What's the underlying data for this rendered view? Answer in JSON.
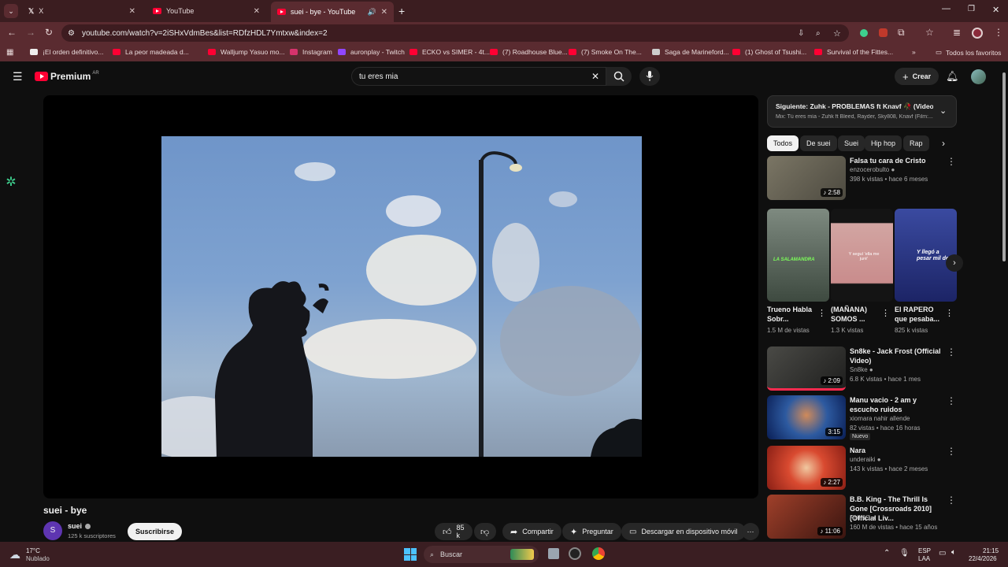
{
  "tabs": [
    {
      "label": "X"
    },
    {
      "label": "YouTube"
    },
    {
      "label": "suei - bye - YouTube"
    }
  ],
  "url": "youtube.com/watch?v=2iSHxVdmBes&list=RDfzHDL7Ymtxw&index=2",
  "bookmarks": [
    {
      "label": "¡El orden definitivo..."
    },
    {
      "label": "La peor madeada d..."
    },
    {
      "label": "Walljump Yasuo mo..."
    },
    {
      "label": "Instagram"
    },
    {
      "label": "auronplay - Twitch"
    },
    {
      "label": "ECKO vs SIMER - 4t..."
    },
    {
      "label": "(7) Roadhouse Blue..."
    },
    {
      "label": "(7) Smoke On The..."
    },
    {
      "label": "Saga de Marineford..."
    },
    {
      "label": "(1) Ghost of Tsushi..."
    },
    {
      "label": "Survival of the Fittes..."
    },
    {
      "label": "Todos los favoritos"
    }
  ],
  "yt": {
    "logo": "Premium",
    "region": "AR",
    "search_value": "tu eres mia",
    "create_label": "Crear"
  },
  "video": {
    "title": "suei - bye",
    "channel": "suei",
    "channel_initial": "S",
    "subscribers": "125 k suscriptores",
    "subscribe_label": "Suscribirse",
    "likes": "85 k",
    "share_label": "Compartir",
    "ask_label": "Preguntar",
    "download_label": "Descargar en dispositivo móvil"
  },
  "up_next": {
    "title": "Siguiente: Zuhk - PROBLEMAS ft Knavf 🥀 (Video ...",
    "subtitle": "Mix: Tú eres mía - Zuhk ft Bleed, Rayder, Sky808, Knavf (Film:..."
  },
  "chips": [
    "Todos",
    "De suei",
    "Suei",
    "Hip hop",
    "Rap"
  ],
  "recommendations": [
    {
      "title": "Falsa tu cara de Cristo",
      "channel": "enzocerobulto",
      "meta": "398 k vistas • hace 6 meses",
      "duration": "2:58",
      "color": "#6b6b5a"
    },
    {
      "title": "Sn8ke - Jack Frost (Official Video)",
      "channel": "Sn8ke",
      "meta": "6.8 K vistas • hace 1 mes",
      "duration": "2:09",
      "color": "#3a3a38"
    },
    {
      "title": "Manu vacio - 2 am y escucho ruidos",
      "channel": "xiomara nahir allende",
      "meta": "82 vistas • hace 16 horas",
      "duration": "3:15",
      "badge": "Nuevo",
      "color": "#2d5aa0"
    },
    {
      "title": "Nara",
      "channel": "underaiki",
      "meta": "143 k vistas • hace 2 meses",
      "duration": "2:27",
      "color": "#c4402a"
    },
    {
      "title": "B.B. King - The Thrill Is Gone [Crossroads 2010] (Official Liv...",
      "channel": "RHINO",
      "meta": "160 M de vistas • hace 15 años",
      "duration": "11:06",
      "color": "#7a2a20"
    }
  ],
  "shorts": [
    {
      "title": "Trueno Habla Sobr...",
      "views": "1.5 M de vistas",
      "overlay": "LA SALAMANDRA",
      "color": "#5a6a5c"
    },
    {
      "title": "(MAÑANA) SOMOS ...",
      "views": "1.3 K vistas",
      "overlay": "Y seguí 'ella me juré'",
      "color": "#c48a8a"
    },
    {
      "title": "El RAPERO que pesaba...",
      "views": "825 k vistas",
      "overlay": "Y llegó a pesar mil de",
      "color": "#2a3a8a"
    }
  ],
  "taskbar": {
    "temp": "17°C",
    "weather": "Nublado",
    "search": "Buscar",
    "lang": "ESP",
    "layout": "LAA",
    "time": "21:15",
    "date": "22/4/2026"
  }
}
